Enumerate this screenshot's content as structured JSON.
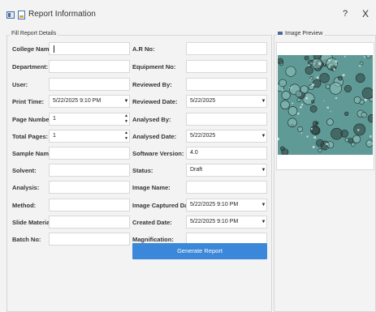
{
  "window": {
    "title": "Report Information",
    "help_label": "?",
    "close_label": "X"
  },
  "form": {
    "legend": "Fill Report Details",
    "left": [
      {
        "label": "College Name:",
        "value": "",
        "kind": "text"
      },
      {
        "label": "Department:",
        "value": "",
        "kind": "text"
      },
      {
        "label": "User:",
        "value": "",
        "kind": "text"
      },
      {
        "label": "Print Time:",
        "value": "5/22/2025 9:10 PM",
        "kind": "combo"
      },
      {
        "label": "Page Number:",
        "value": "1",
        "kind": "spin"
      },
      {
        "label": "Total Pages:",
        "value": "1",
        "kind": "spin"
      },
      {
        "label": "Sample Name:",
        "value": "",
        "kind": "text"
      },
      {
        "label": "Solvent:",
        "value": "",
        "kind": "text"
      },
      {
        "label": "Analysis:",
        "value": "",
        "kind": "text"
      },
      {
        "label": "Method:",
        "value": "",
        "kind": "text"
      },
      {
        "label": "Slide Material:",
        "value": "",
        "kind": "text"
      },
      {
        "label": "Batch No:",
        "value": "",
        "kind": "text"
      }
    ],
    "right": [
      {
        "label": "A.R No:",
        "value": "",
        "kind": "text"
      },
      {
        "label": "Equipment No:",
        "value": "",
        "kind": "text"
      },
      {
        "label": "Reviewed By:",
        "value": "",
        "kind": "text"
      },
      {
        "label": "Reviewed Date:",
        "value": "5/22/2025",
        "kind": "combo"
      },
      {
        "label": "Analysed By:",
        "value": "",
        "kind": "text"
      },
      {
        "label": "Analysed Date:",
        "value": "5/22/2025",
        "kind": "combo"
      },
      {
        "label": "Software Version:",
        "value": "4.0",
        "kind": "text"
      },
      {
        "label": "Status:",
        "value": "Draft",
        "kind": "combo"
      },
      {
        "label": "Image Name:",
        "value": "",
        "kind": "text"
      },
      {
        "label": "Image Captured Date:",
        "value": "5/22/2025 9:10 PM",
        "kind": "combo"
      },
      {
        "label": "Created Date:",
        "value": "5/22/2025 9:10 PM",
        "kind": "combo"
      },
      {
        "label": "Magnification:",
        "value": "",
        "kind": "text"
      }
    ],
    "generate_label": "Generate Report"
  },
  "preview": {
    "legend": "Image Preview",
    "image_bg": "#5f9a96"
  },
  "colors": {
    "accent": "#3b87d9",
    "window_bg": "#f3f3f3"
  }
}
